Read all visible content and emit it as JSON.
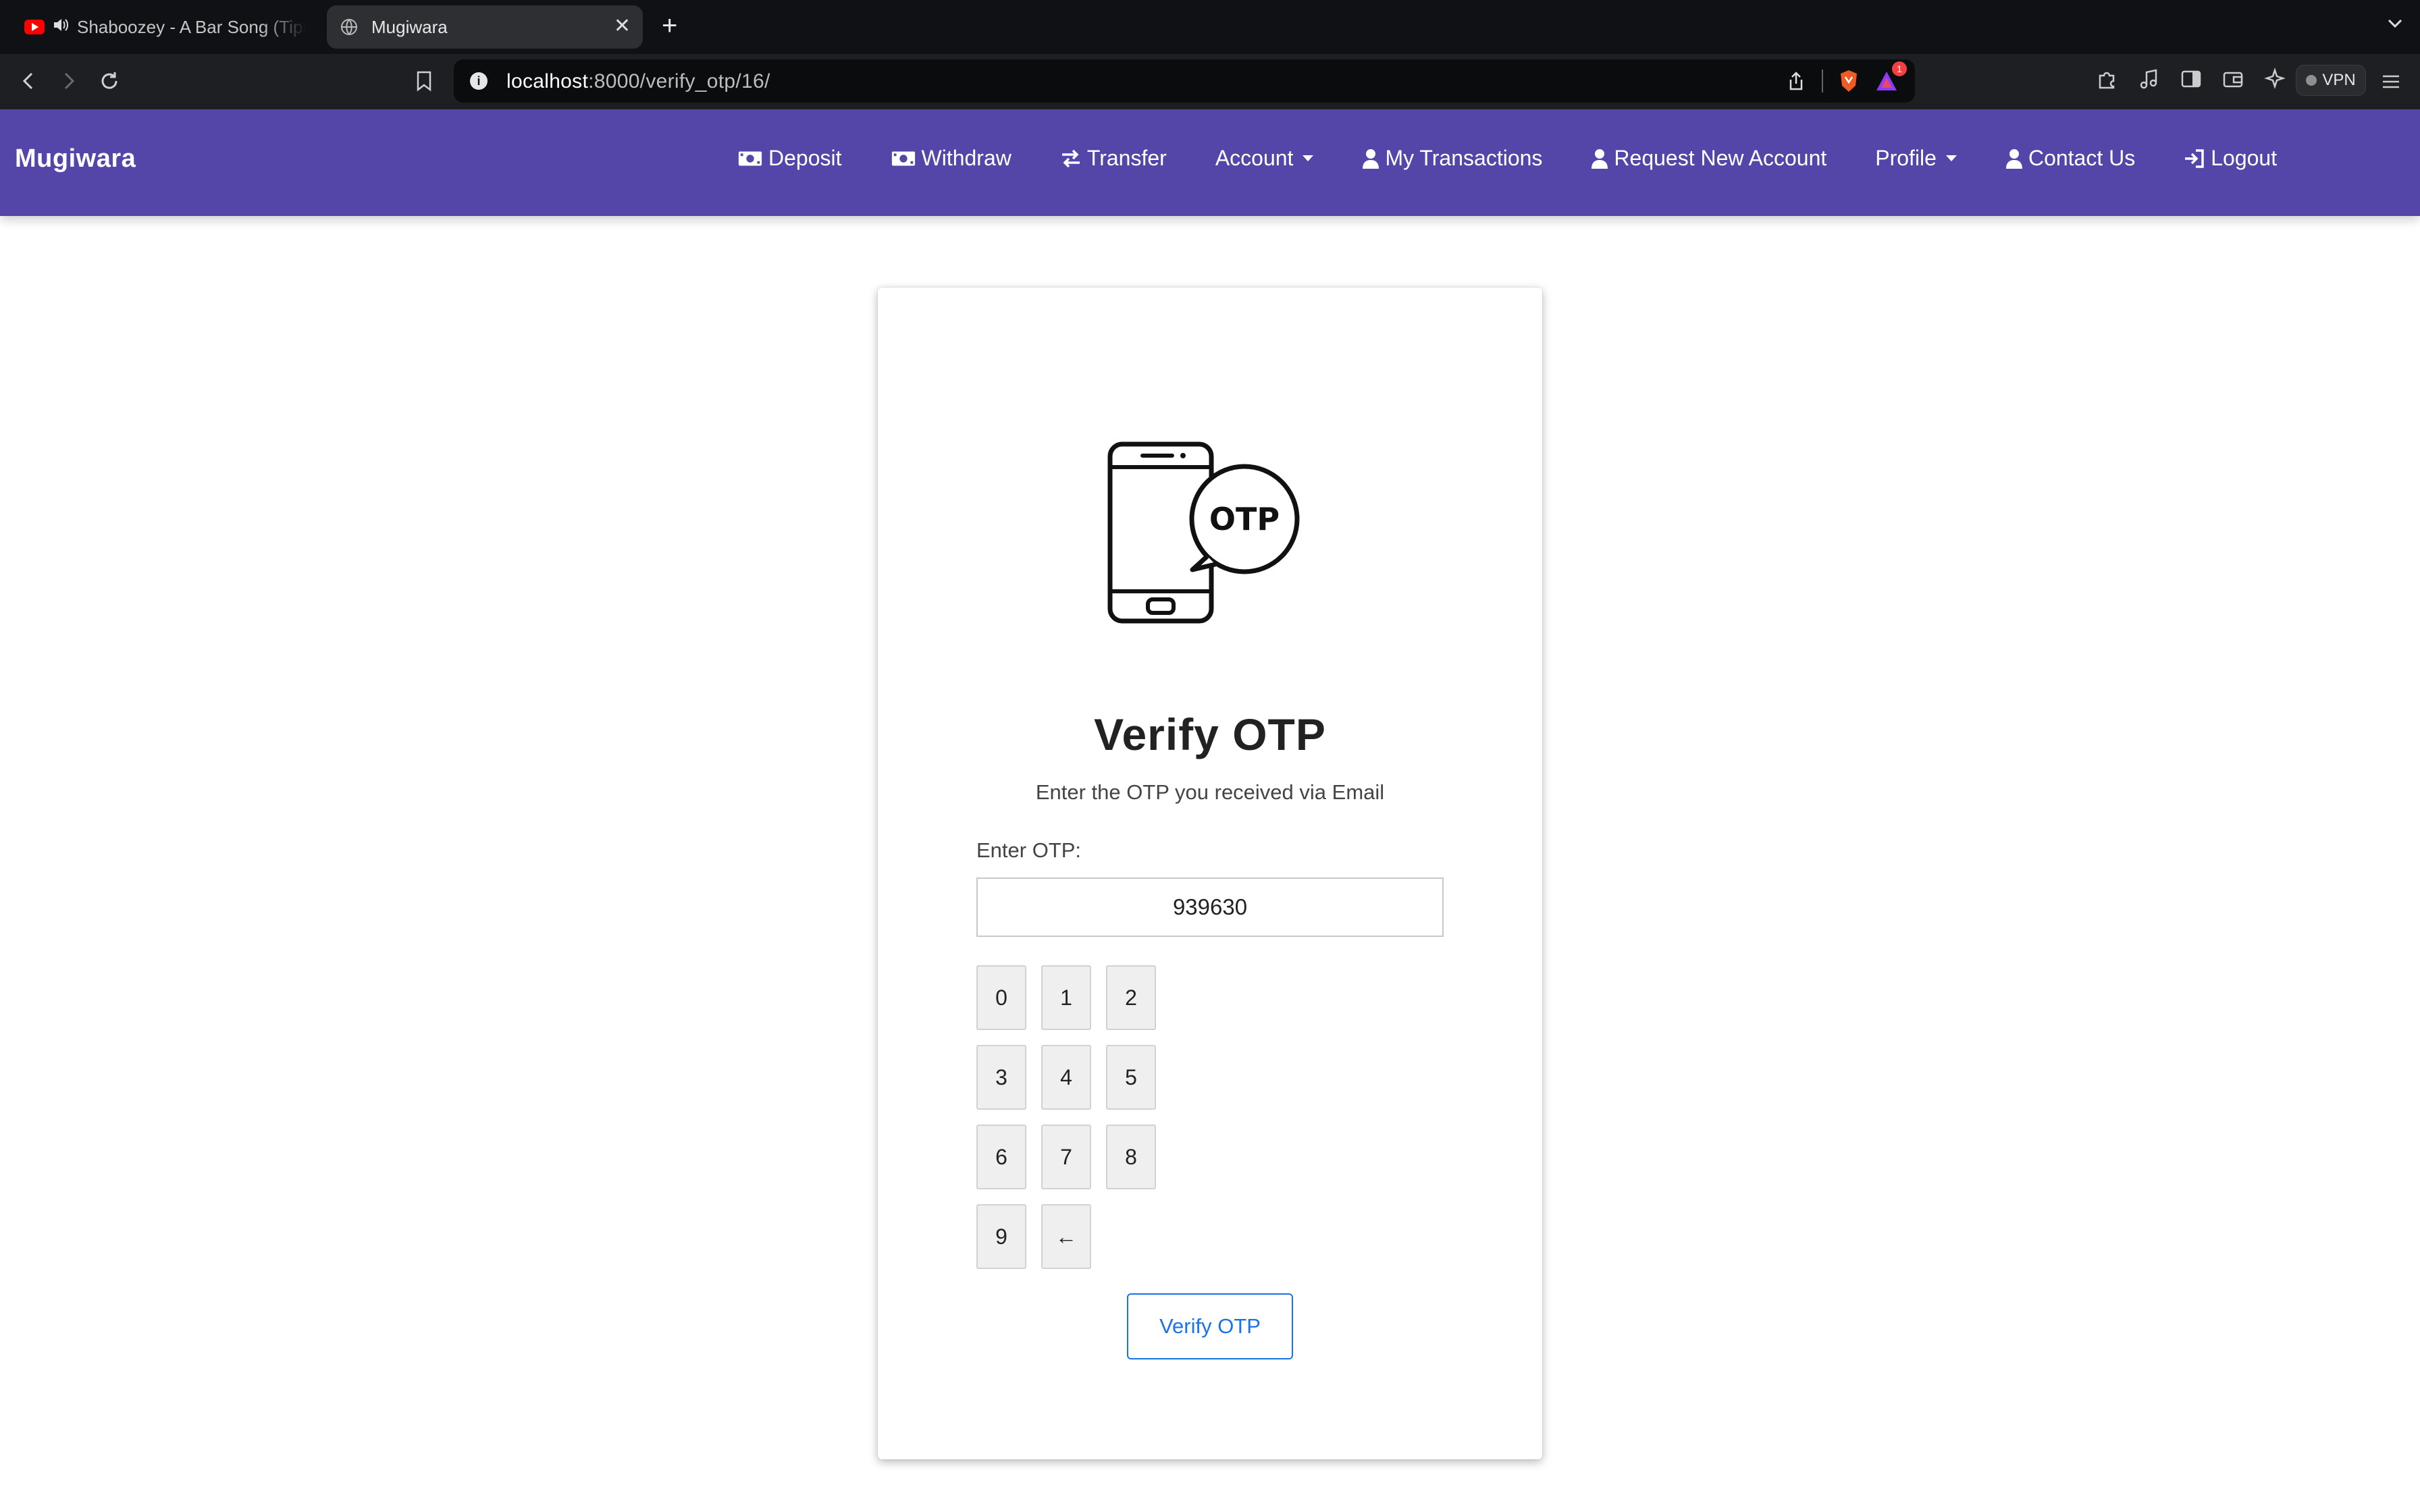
{
  "browser": {
    "tabs": [
      {
        "title": "Shaboozey - A Bar Song (Tipsy)",
        "active": false,
        "icon": "youtube-icon",
        "audio": true
      },
      {
        "title": "Mugiwara",
        "active": true,
        "icon": "globe-icon"
      }
    ],
    "url_host": "localhost",
    "url_path": ":8000/verify_otp/16/",
    "rewards_badge": "1",
    "vpn_label": "VPN"
  },
  "navbar": {
    "brand": "Mugiwara",
    "items": [
      {
        "label": "Deposit",
        "icon": "money-bill-icon"
      },
      {
        "label": "Withdraw",
        "icon": "money-bill-icon"
      },
      {
        "label": "Transfer",
        "icon": "exchange-arrows-icon"
      },
      {
        "label": "Account",
        "dropdown": true
      },
      {
        "label": "My Transactions",
        "icon": "user-icon"
      },
      {
        "label": "Request New Account",
        "icon": "user-icon"
      },
      {
        "label": "Profile",
        "dropdown": true
      },
      {
        "label": "Contact Us",
        "icon": "user-icon"
      },
      {
        "label": "Logout",
        "icon": "sign-in-icon"
      }
    ],
    "color": "#5446a8"
  },
  "card": {
    "illustration_text": "OTP",
    "title": "Verify OTP",
    "subtitle": "Enter the OTP you received via Email",
    "otp_label": "Enter OTP:",
    "otp_value": "939630",
    "keypad": [
      "0",
      "1",
      "2",
      "3",
      "4",
      "5",
      "6",
      "7",
      "8",
      "9",
      "←"
    ],
    "submit_label": "Verify OTP",
    "accent_color": "#1a73e8"
  }
}
